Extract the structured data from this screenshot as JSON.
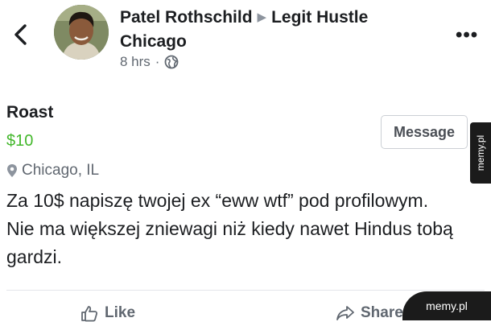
{
  "header": {
    "author_name": "Patel Rothschild",
    "group_name": "Legit Hustle Chicago",
    "timestamp": "8 hrs",
    "separator": "·",
    "privacy_icon": "globe-icon",
    "more_label": "•••"
  },
  "listing": {
    "title": "Roast",
    "price": "$10",
    "location": "Chicago, IL",
    "message_button": "Message",
    "description": "Za 10$ napiszę twojej ex “eww wtf” pod profilowym. Nie ma większej zniewagi niż kiedy nawet Hindus tobą gardzi."
  },
  "actions": {
    "like": "Like",
    "share": "Share"
  },
  "watermarks": {
    "side": "memy.pl",
    "corner": "memy.pl"
  },
  "colors": {
    "price": "#42b72a",
    "secondary_text": "#606770"
  }
}
